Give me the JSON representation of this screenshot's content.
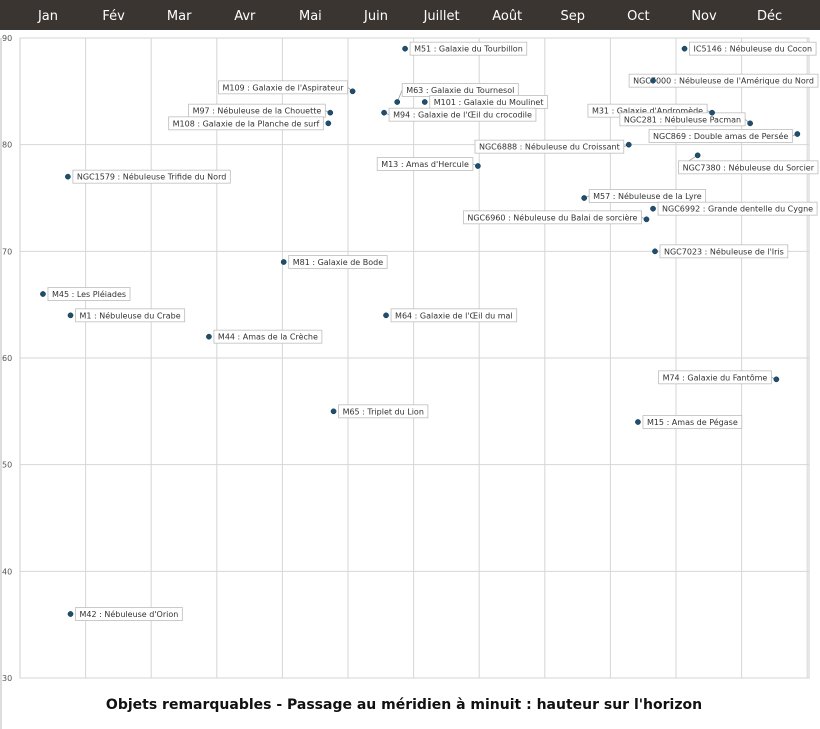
{
  "chart_data": {
    "type": "scatter",
    "title": "Objets remarquables - Passage au méridien à minuit : hauteur sur l'horizon",
    "categories": [
      "Jan",
      "Fév",
      "Mar",
      "Avr",
      "Mai",
      "Juin",
      "Juillet",
      "Août",
      "Sep",
      "Oct",
      "Nov",
      "Déc"
    ],
    "ylim": [
      30,
      90
    ],
    "yticks": [
      30,
      40,
      50,
      60,
      70,
      80,
      90
    ],
    "xlim": [
      0.3,
      12.5
    ],
    "grid": true,
    "points": [
      {
        "label": "NGC1579 : Nébuleuse Trifide du Nord",
        "x": 0.73,
        "y": 77
      },
      {
        "label": "M45 : Les Pléiades",
        "x": 0.35,
        "y": 66
      },
      {
        "label": "M1 : Nébuleuse du Crabe",
        "x": 0.77,
        "y": 64
      },
      {
        "label": "M42 : Nébuleuse d'Orion",
        "x": 0.77,
        "y": 36
      },
      {
        "label": "M44 : Amas de la Crèche",
        "x": 2.88,
        "y": 62
      },
      {
        "label": "M81 : Galaxie de Bode",
        "x": 4.02,
        "y": 69
      },
      {
        "label": "M109 : Galaxie de l'Aspirateur",
        "x": 5.07,
        "y": 85
      },
      {
        "label": "M97 : Nébuleuse de la Chouette",
        "x": 4.73,
        "y": 83
      },
      {
        "label": "M108 : Galaxie de la Planche de surf",
        "x": 4.7,
        "y": 82
      },
      {
        "label": "M65 : Triplet du Lion",
        "x": 4.78,
        "y": 55
      },
      {
        "label": "M51 : Galaxie du Tourbillon",
        "x": 5.87,
        "y": 89
      },
      {
        "label": "M63 : Galaxie du Tournesol",
        "x": 5.75,
        "y": 84
      },
      {
        "label": "M101 : Galaxie du Moulinet",
        "x": 6.17,
        "y": 84
      },
      {
        "label": "M94 : Galaxie de l'Œil du crocodile",
        "x": 5.55,
        "y": 83
      },
      {
        "label": "M13 : Amas d'Hercule",
        "x": 6.98,
        "y": 78
      },
      {
        "label": "M64 : Galaxie de l'Œil du mal",
        "x": 5.58,
        "y": 64
      },
      {
        "label": "NGC6888 : Nébuleuse du Croissant",
        "x": 9.28,
        "y": 80
      },
      {
        "label": "M57 : Nébuleuse de la Lyre",
        "x": 8.6,
        "y": 75
      },
      {
        "label": "NGC6960 : Nébuleuse du Balai de sorcière",
        "x": 9.55,
        "y": 73
      },
      {
        "label": "NGC6992 : Grande dentelle du Cygne",
        "x": 9.65,
        "y": 74
      },
      {
        "label": "NGC7023 : Nébuleuse de l'Iris",
        "x": 9.68,
        "y": 70
      },
      {
        "label": "M15 : Amas de Pégase",
        "x": 9.42,
        "y": 54
      },
      {
        "label": "IC5146 : Nébuleuse du Cocon",
        "x": 10.13,
        "y": 89
      },
      {
        "label": "NGC7000 : Nébuleuse de l'Amérique du Nord",
        "x": 9.65,
        "y": 86
      },
      {
        "label": "M31 : Galaxie d'Andromède",
        "x": 10.55,
        "y": 83
      },
      {
        "label": "NGC281 : Nébuleuse Pacman",
        "x": 11.13,
        "y": 82
      },
      {
        "label": "NGC869 : Double amas de Persée",
        "x": 11.85,
        "y": 81
      },
      {
        "label": "NGC7380 : Nébuleuse du Sorcier",
        "x": 10.33,
        "y": 79
      },
      {
        "label": "M74 : Galaxie du Fantôme",
        "x": 11.53,
        "y": 58
      }
    ]
  }
}
